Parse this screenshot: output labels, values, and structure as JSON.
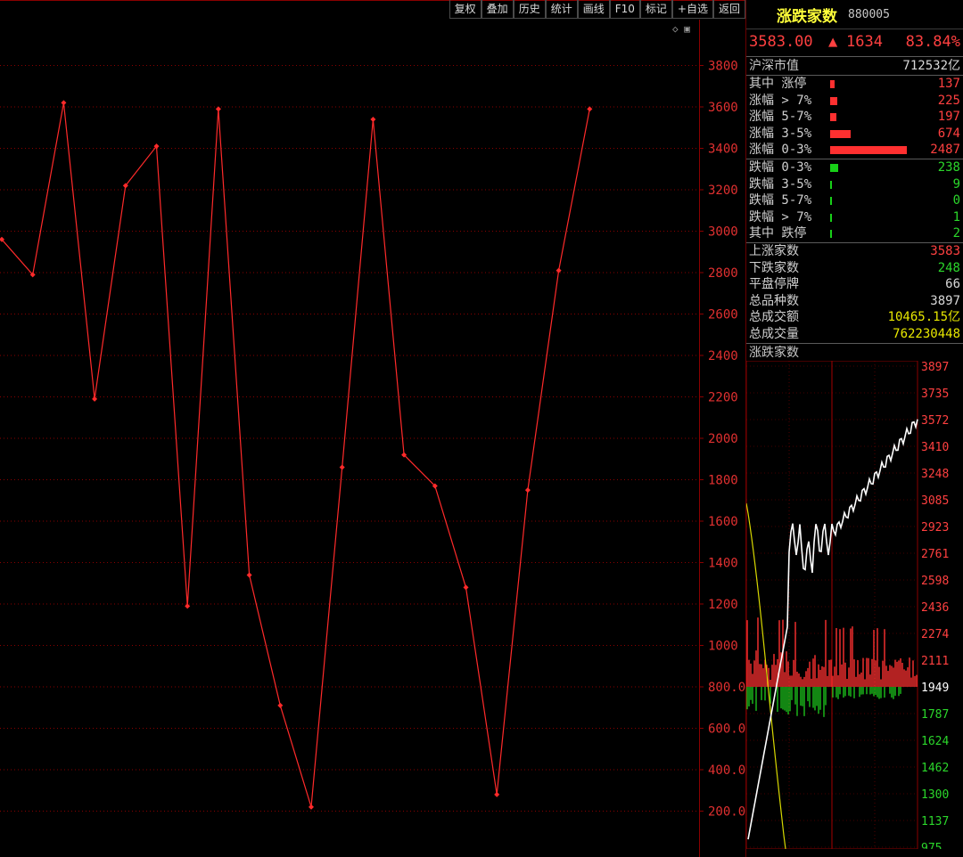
{
  "toolbar": {
    "items": [
      "复权",
      "叠加",
      "历史",
      "统计",
      "画线",
      "F10",
      "标记",
      "+自选",
      "返回"
    ]
  },
  "axis_icons": "◇ ▣",
  "chart_data": {
    "type": "line",
    "x": [
      1,
      2,
      3,
      4,
      5,
      6,
      7,
      8,
      9,
      10,
      11,
      12,
      13,
      14,
      15,
      16,
      17,
      18,
      19,
      20
    ],
    "values": [
      2960,
      2790,
      3620,
      2190,
      3220,
      3410,
      1190,
      3590,
      1340,
      710,
      220,
      1860,
      3540,
      1920,
      1770,
      1280,
      280,
      1750,
      2810,
      3590
    ],
    "yticks": [
      "3800",
      "3600",
      "3400",
      "3200",
      "3000",
      "2800",
      "2600",
      "2400",
      "2200",
      "2000",
      "1800",
      "1600",
      "1400",
      "1200",
      "1000",
      "800.0",
      "600.0",
      "400.0",
      "200.0"
    ],
    "ylim": [
      0,
      3900
    ],
    "line_color": "#ff2a2a",
    "grid": true
  },
  "panel": {
    "title": "涨跌家数",
    "code": "880005",
    "price": "3583.00",
    "arrow": "▲",
    "change": "1634",
    "pct": "83.84%",
    "market_cap": {
      "label": "沪深市值",
      "value": "712532亿"
    },
    "up_rows": [
      {
        "label": "其中 涨停",
        "value": "137",
        "frac": 0.06
      },
      {
        "label": "涨幅 > 7%",
        "value": "225",
        "frac": 0.09
      },
      {
        "label": "涨幅 5-7%",
        "value": "197",
        "frac": 0.08
      },
      {
        "label": "涨幅 3-5%",
        "value": "674",
        "frac": 0.27
      },
      {
        "label": "涨幅 0-3%",
        "value": "2487",
        "frac": 1.0
      }
    ],
    "down_rows": [
      {
        "label": "跌幅 0-3%",
        "value": "238",
        "frac": 0.1
      },
      {
        "label": "跌幅 3-5%",
        "value": "9",
        "frac": 0.005
      },
      {
        "label": "跌幅 5-7%",
        "value": "0",
        "frac": 0.005
      },
      {
        "label": "跌幅 > 7%",
        "value": "1",
        "frac": 0.005
      },
      {
        "label": "其中 跌停",
        "value": "2",
        "frac": 0.005
      }
    ],
    "stats": [
      {
        "label": "上涨家数",
        "value": "3583",
        "color": "#ff4040"
      },
      {
        "label": "下跌家数",
        "value": "248",
        "color": "#2bd62b"
      },
      {
        "label": "平盘停牌",
        "value": "66",
        "color": "#d8d8d8"
      },
      {
        "label": "总品种数",
        "value": "3897",
        "color": "#d8d8d8"
      },
      {
        "label": "总成交额",
        "value": "10465.15亿",
        "color": "#e8e800"
      },
      {
        "label": "总成交量",
        "value": "762230448",
        "color": "#e8e800"
      }
    ],
    "mini_title": "涨跌家数",
    "mini_ticks": [
      {
        "v": "3897",
        "c": "#ff4040"
      },
      {
        "v": "3735",
        "c": "#ff4040"
      },
      {
        "v": "3572",
        "c": "#ff4040"
      },
      {
        "v": "3410",
        "c": "#ff4040"
      },
      {
        "v": "3248",
        "c": "#ff4040"
      },
      {
        "v": "3085",
        "c": "#ff4040"
      },
      {
        "v": "2923",
        "c": "#ff4040"
      },
      {
        "v": "2761",
        "c": "#ff4040"
      },
      {
        "v": "2598",
        "c": "#ff4040"
      },
      {
        "v": "2436",
        "c": "#ff4040"
      },
      {
        "v": "2274",
        "c": "#ff4040"
      },
      {
        "v": "2111",
        "c": "#ff4040"
      },
      {
        "v": "1949",
        "c": "#ffffff"
      },
      {
        "v": "1787",
        "c": "#2bd62b"
      },
      {
        "v": "1624",
        "c": "#2bd62b"
      },
      {
        "v": "1462",
        "c": "#2bd62b"
      },
      {
        "v": "1300",
        "c": "#2bd62b"
      },
      {
        "v": "1137",
        "c": "#2bd62b"
      },
      {
        "v": "975",
        "c": "#2bd62b"
      }
    ]
  }
}
